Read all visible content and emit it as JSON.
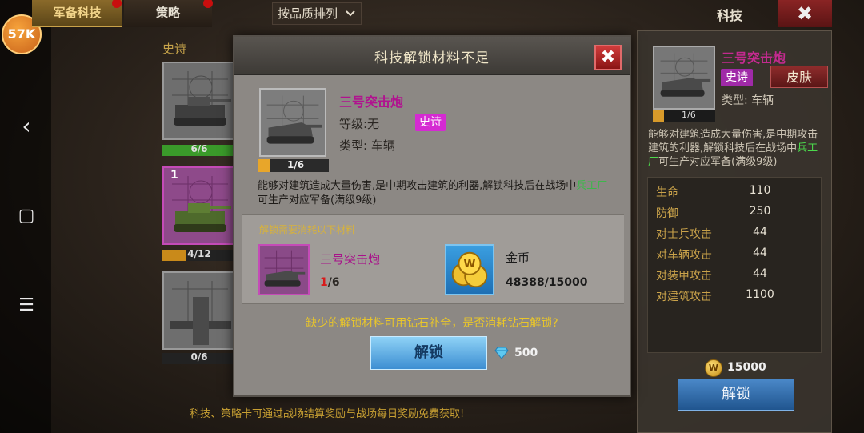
{
  "nav": {
    "back_icon": "‹",
    "home_icon": "▢",
    "menu_icon": "☰",
    "logo_text": "57K"
  },
  "tabs": {
    "active_label": "军备科技",
    "inactive_label": "策略",
    "sort_label": "按品质排列"
  },
  "header": {
    "title": "科技",
    "close_glyph": "✖"
  },
  "list": {
    "rarity_heading": "史诗",
    "cards": [
      {
        "progress": "6/6",
        "fill_fraction": 1.0,
        "fill_color": "#3a9a2a",
        "badge": ""
      },
      {
        "progress": "4/12",
        "fill_fraction": 0.33,
        "fill_color": "#c98a1a",
        "badge": "1"
      },
      {
        "progress": "0/6",
        "fill_fraction": 0.0,
        "fill_color": "#c98a1a",
        "badge": ""
      }
    ],
    "hint": "科技、策略卡可通过战场结算奖励与战场每日奖励免费获取!"
  },
  "detail": {
    "name": "三号突击炮",
    "rarity": "史诗",
    "skin_label": "皮肤",
    "type": "类型: 车辆",
    "progress": "1/6",
    "desc_before": "能够对建筑造成大量伤害,是中期攻击建筑的利器,解锁科技后在战场中",
    "desc_highlight": "兵工厂",
    "desc_after": "可生产对应军备(满级9级)",
    "stats": [
      {
        "label": "生命",
        "value": "110"
      },
      {
        "label": "防御",
        "value": "250"
      },
      {
        "label": "对士兵攻击",
        "value": "44"
      },
      {
        "label": "对车辆攻击",
        "value": "44"
      },
      {
        "label": "对装甲攻击",
        "value": "44"
      },
      {
        "label": "对建筑攻击",
        "value": "1100"
      }
    ],
    "cost": "15000",
    "coin_glyph": "W",
    "unlock_label": "解锁"
  },
  "modal": {
    "title": "科技解锁材料不足",
    "close_glyph": "✖",
    "name": "三号突击炮",
    "level": "等级:无",
    "rarity": "史诗",
    "type": "类型: 车辆",
    "progress": "1/6",
    "desc_before": "能够对建筑造成大量伤害,是中期攻击建筑的利器,解锁科技后在战场中",
    "desc_highlight": "兵工厂",
    "desc_after": "可生产对应军备(满级9级)",
    "materials_label": "解锁需要消耗以下材料",
    "material_name": "三号突击炮",
    "material_have": "1",
    "material_need": "/6",
    "coin_name": "金币",
    "coin_count": "48388/15000",
    "coin_glyph": "W",
    "prompt": "缺少的解锁材料可用钻石补全，是否消耗钻石解锁?",
    "unlock_label": "解锁",
    "diamond_cost": "500"
  },
  "colors": {
    "epic_purple": "#b1128f",
    "gold_text": "#e9c62a",
    "highlight_green": "#3cb84a",
    "danger_red": "#c81e1e",
    "unlock_blue": "#3d8ed2"
  }
}
